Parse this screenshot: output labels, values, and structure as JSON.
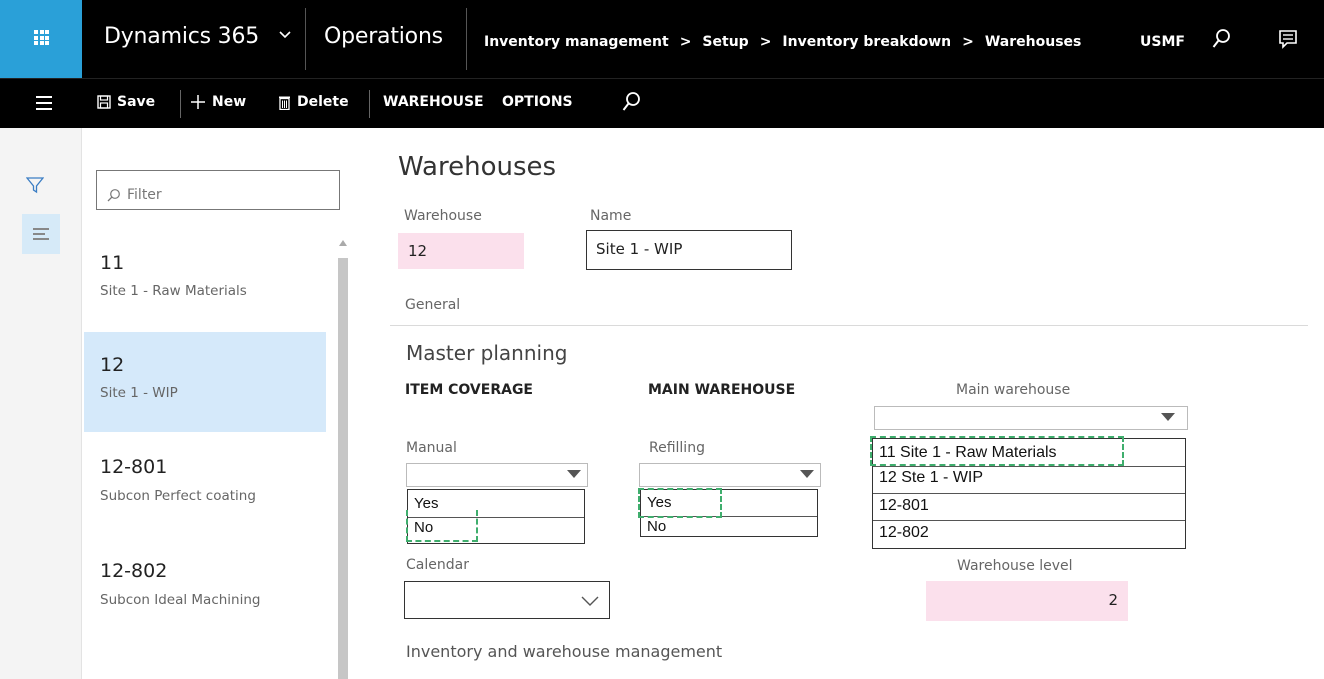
{
  "topbar": {
    "brand": "Dynamics 365",
    "app": "Operations",
    "breadcrumb": [
      "Inventory management",
      "Setup",
      "Inventory breakdown",
      "Warehouses"
    ],
    "breadcrumb_sep": ">",
    "company": "USMF",
    "icons": [
      "app-launcher-icon",
      "chevron-down-icon",
      "search-icon",
      "message-icon"
    ]
  },
  "actionbar": {
    "save": "Save",
    "new": "New",
    "delete": "Delete",
    "warehouse": "WAREHOUSE",
    "options": "OPTIONS",
    "icons": [
      "hamburger-icon",
      "save-icon",
      "plus-icon",
      "trash-icon",
      "search-icon"
    ]
  },
  "listpane": {
    "filter_placeholder": "Filter",
    "items": [
      {
        "code": "11",
        "name": "Site 1 - Raw Materials",
        "selected": false
      },
      {
        "code": "12",
        "name": "Site 1 - WIP",
        "selected": true
      },
      {
        "code": "12-801",
        "name": "Subcon Perfect coating",
        "selected": false
      },
      {
        "code": "12-802",
        "name": "Subcon Ideal Machining",
        "selected": false
      }
    ]
  },
  "form": {
    "title": "Warehouses",
    "warehouse_label": "Warehouse",
    "warehouse_value": "12",
    "name_label": "Name",
    "name_value": "Site 1 - WIP",
    "general_label": "General",
    "master_planning": "Master planning",
    "item_coverage": "ITEM COVERAGE",
    "main_warehouse_head": "MAIN WAREHOUSE",
    "main_warehouse_label": "Main warehouse",
    "manual_label": "Manual",
    "manual_options": [
      "Yes",
      "No"
    ],
    "refilling_label": "Refilling",
    "refilling_options": [
      "Yes",
      "No"
    ],
    "main_warehouse_options": [
      "11 Site 1 - Raw Materials",
      "12 Ste 1 - WIP",
      "12-801",
      "12-802"
    ],
    "calendar_label": "Calendar",
    "calendar_value": "",
    "warehouse_level_label": "Warehouse level",
    "warehouse_level_value": "2",
    "inventory_section": "Inventory and warehouse management"
  },
  "colors": {
    "nav_bg": "#000000",
    "launcher_bg": "#2aa0d8",
    "selected_row": "#d5e9fa",
    "readonly_field": "#fbe0ec",
    "dash_highlight": "#3fae6d"
  }
}
